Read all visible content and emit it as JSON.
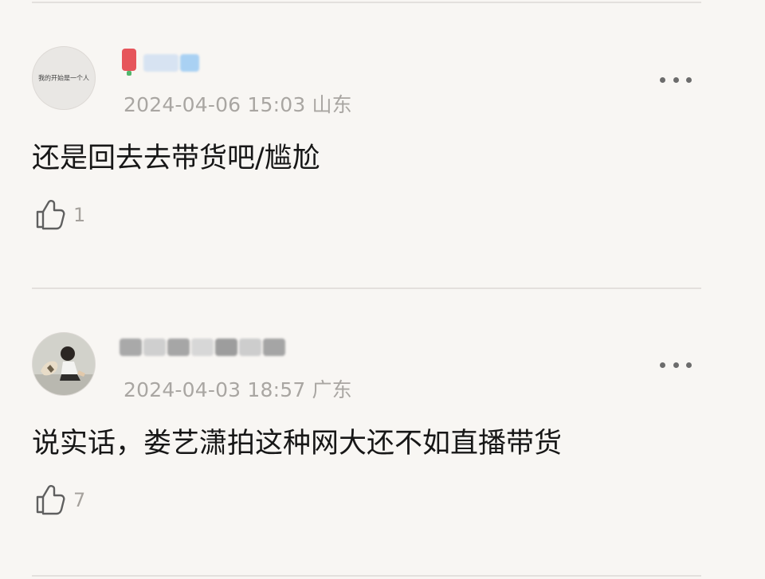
{
  "comments": [
    {
      "avatar_text": "我的开始是一个人",
      "timestamp": "2024-04-06 15:03",
      "location": "山东",
      "text": "还是回去去带货吧/尴尬",
      "likes": "1",
      "more_icon": "more-horizontal-icon",
      "like_icon": "thumbs-up-icon"
    },
    {
      "timestamp": "2024-04-03 18:57",
      "location": "广东",
      "text": "说实话，娄艺潇拍这种网大还不如直播带货",
      "likes": "7",
      "more_icon": "more-horizontal-icon",
      "like_icon": "thumbs-up-icon"
    }
  ],
  "colors": {
    "background": "#f8f6f3",
    "meta_text": "#a9a6a2",
    "content_text": "#171717",
    "divider": "#e3e0dd"
  }
}
